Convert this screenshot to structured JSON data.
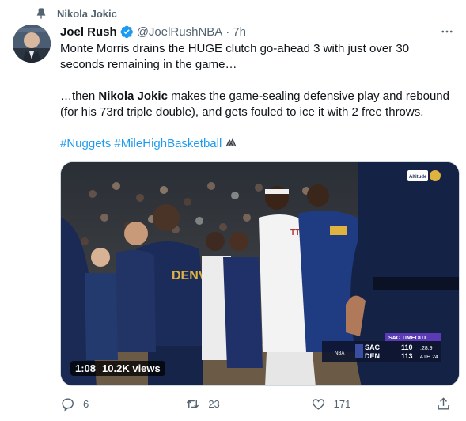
{
  "social_context": {
    "text": "Nikola Jokic",
    "icon": "pin-icon"
  },
  "tweet": {
    "author_name": "Joel Rush",
    "handle": "@JoelRushNBA",
    "separator": "·",
    "time": "7h",
    "paragraph1": "Monte Morris drains the HUGE clutch go-ahead 3 with just over 30 seconds remaining in the game…",
    "paragraph2_prefix": "…then ",
    "paragraph2_bold": "Nikola Jokic",
    "paragraph2_rest": " makes the game-sealing defensive play and rebound (for his 73rd triple double), and gets fouled to ice it with 2 free throws.",
    "hashtag1": "#Nuggets",
    "hashtag2": "#MileHighBasketball",
    "emoji_icon": "nuggets-emoji-icon",
    "accent_color": "#1d9bf0"
  },
  "media": {
    "duration": "1:08",
    "views": "10.2K views",
    "jersey_text": "DENVER",
    "jersey_text2": "TTO",
    "scorebug": {
      "banner": "SAC TIMEOUT",
      "team1": "SAC",
      "score1": "110",
      "clock": ":28.9",
      "team2": "DEN",
      "score2": "113",
      "period": "4TH 24"
    },
    "corner_logo": "Altitude",
    "corner_logo2": "NBA"
  },
  "actions": {
    "replies": "6",
    "retweets": "23",
    "likes": "171"
  }
}
